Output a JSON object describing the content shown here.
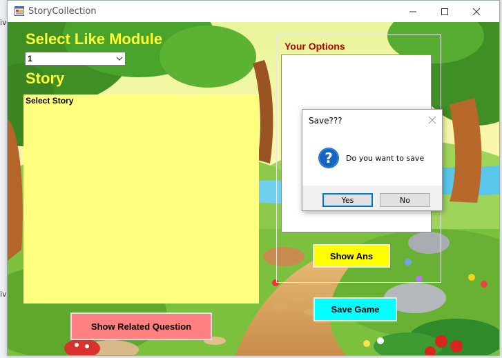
{
  "window": {
    "title": "StoryCollection"
  },
  "form": {
    "module_heading": "Select Like Module",
    "module_selected": "1",
    "story_heading": "Story",
    "story_label": "Select Story",
    "options_title": "Your Options",
    "show_ans_label": "Show Ans",
    "save_game_label": "Save Game",
    "related_question_label": "Show Related Question"
  },
  "dialog": {
    "title": "Save???",
    "message": "Do you want to save",
    "yes_label": "Yes",
    "no_label": "No"
  },
  "background_fragments": {
    "top": "iv",
    "bottom": "iv"
  },
  "colors": {
    "heading": "#ffff33",
    "options_title": "#b00000",
    "story_box": "#ffff80",
    "show_ans": "#ffff00",
    "save_game": "#00ffff",
    "related_question": "#ff8080"
  }
}
